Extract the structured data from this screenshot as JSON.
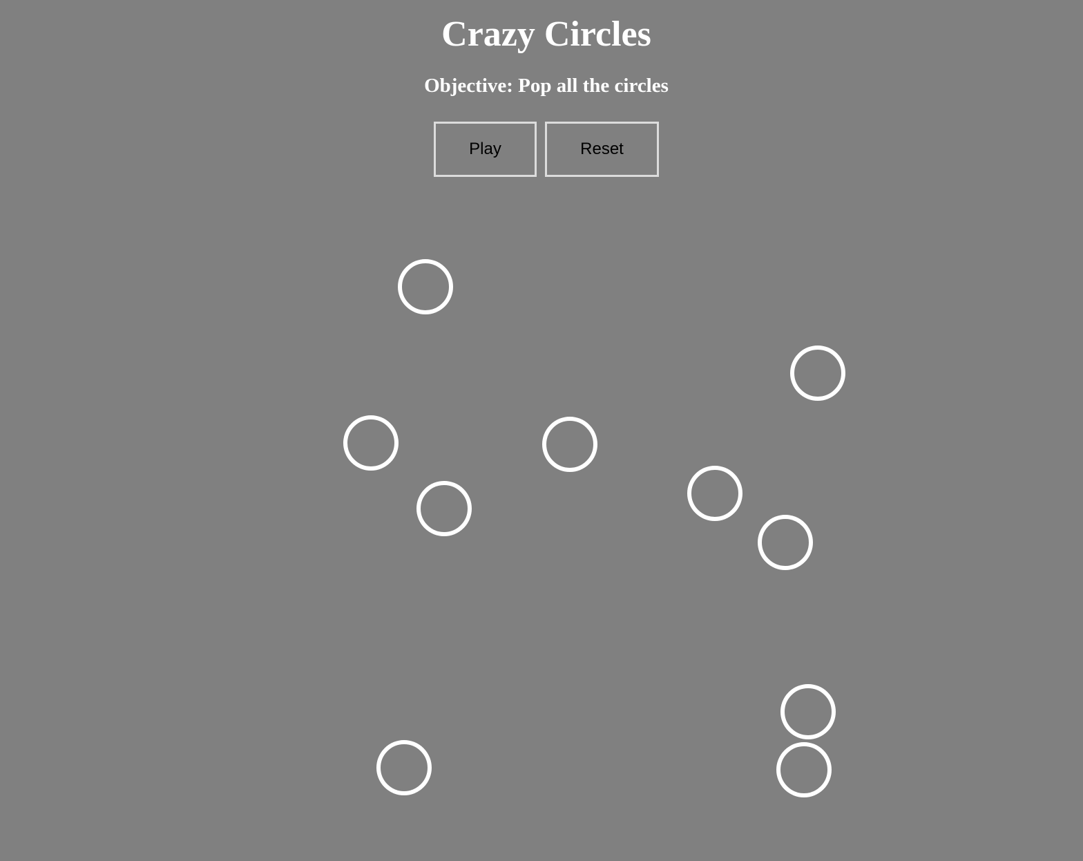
{
  "game": {
    "title": "Crazy Circles",
    "objective": "Objective: Pop all the circles"
  },
  "controls": {
    "play_label": "Play",
    "reset_label": "Reset"
  },
  "colors": {
    "background": "#808080",
    "text": "#ffffff",
    "circle_stroke": "#ffffff",
    "button_border": "#dcdcdc",
    "button_text": "#000000"
  }
}
